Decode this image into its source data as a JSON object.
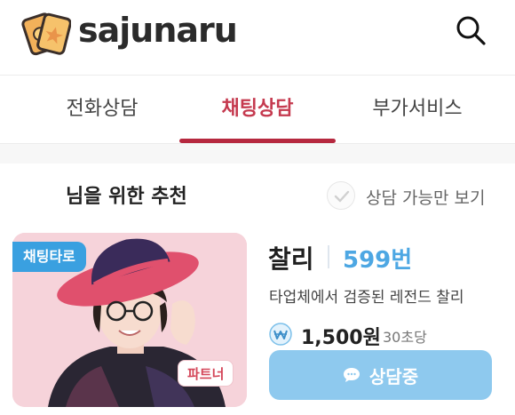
{
  "header": {
    "brand": "sajunaru",
    "logo_icon": "tarot-cards-logo-icon",
    "search_icon": "search-icon"
  },
  "tabs": [
    {
      "label": "전화상담",
      "active": false
    },
    {
      "label": "채팅상담",
      "active": true
    },
    {
      "label": "부가서비스",
      "active": false
    }
  ],
  "section": {
    "title": "님을 위한 추천",
    "filter_label": "상담 가능만 보기",
    "filter_checked": false
  },
  "card": {
    "category_badge": "채팅타로",
    "partner_badge": "파트너",
    "name": "찰리",
    "number": "599번",
    "description": "타업체에서 검증된 레전드 찰리",
    "price": "1,500원",
    "unit": "30초당",
    "button_label": "상담중"
  },
  "colors": {
    "accent": "#b6283f",
    "active_tab_text": "#c53a4f",
    "number": "#4da7e3",
    "badge": "#3aa0e0",
    "button": "#8ec9ee",
    "card_bg": "#f6d3da"
  }
}
